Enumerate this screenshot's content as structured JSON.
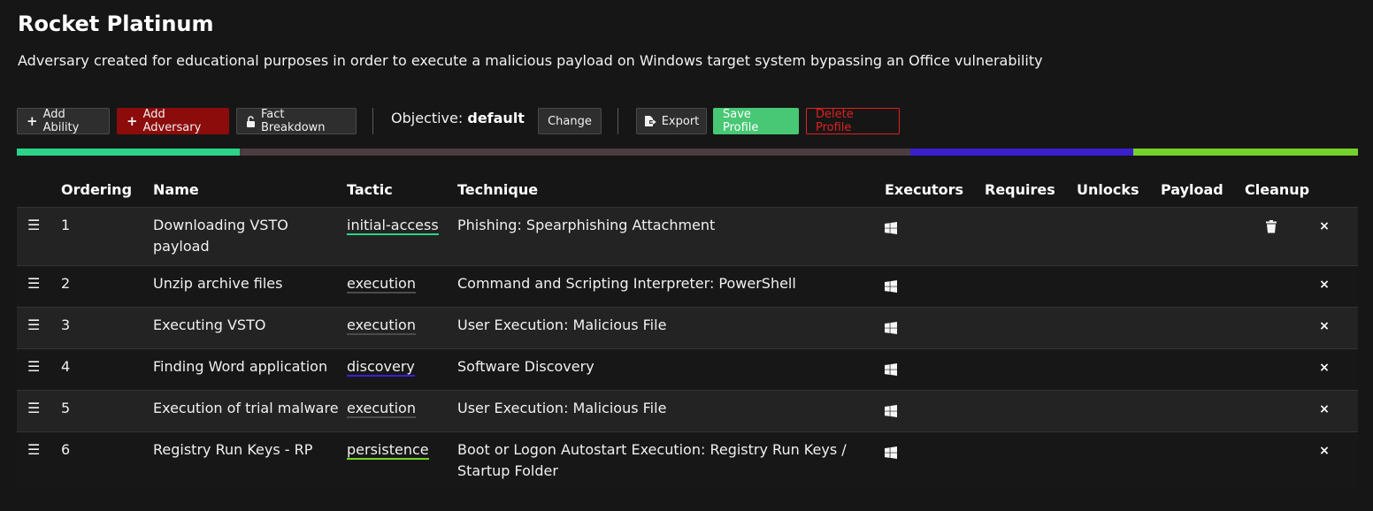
{
  "title": "Rocket Platinum",
  "description": "Adversary created for educational purposes in order to execute a malicious payload on Windows target system bypassing an Office vulnerability",
  "toolbar": {
    "add_ability": "Add Ability",
    "add_adversary": "Add Adversary",
    "fact_breakdown": "Fact Breakdown",
    "objective_label": "Objective:",
    "objective_value": "default",
    "change": "Change",
    "export": "Export",
    "save_profile": "Save Profile",
    "delete_profile": "Delete Profile"
  },
  "tactic_bar": [
    {
      "color": "#2bd38a",
      "fraction": 0.166
    },
    {
      "color": "#4b3d40",
      "fraction": 0.5
    },
    {
      "color": "#3a1fcf",
      "fraction": 0.166
    },
    {
      "color": "#74d22a",
      "fraction": 0.168
    }
  ],
  "table": {
    "headers": {
      "ordering": "Ordering",
      "name": "Name",
      "tactic": "Tactic",
      "technique": "Technique",
      "executors": "Executors",
      "requires": "Requires",
      "unlocks": "Unlocks",
      "payload": "Payload",
      "cleanup": "Cleanup"
    },
    "rows": [
      {
        "order": "1",
        "name": "Downloading VSTO payload",
        "tactic": "initial-access",
        "technique": "Phishing: Spearphishing Attachment",
        "executor_icon": "windows-icon",
        "has_cleanup": true
      },
      {
        "order": "2",
        "name": "Unzip archive files",
        "tactic": "execution",
        "technique": "Command and Scripting Interpreter: PowerShell",
        "executor_icon": "windows-icon",
        "has_cleanup": false
      },
      {
        "order": "3",
        "name": "Executing VSTO",
        "tactic": "execution",
        "technique": "User Execution: Malicious File",
        "executor_icon": "windows-icon",
        "has_cleanup": false
      },
      {
        "order": "4",
        "name": "Finding Word application",
        "tactic": "discovery",
        "technique": "Software Discovery",
        "executor_icon": "windows-icon",
        "has_cleanup": false
      },
      {
        "order": "5",
        "name": "Execution of trial malware",
        "tactic": "execution",
        "technique": "User Execution: Malicious File",
        "executor_icon": "windows-icon",
        "has_cleanup": false
      },
      {
        "order": "6",
        "name": "Registry Run Keys - RP",
        "tactic": "persistence",
        "technique": "Boot or Logon Autostart Execution: Registry Run Keys / Startup Folder",
        "executor_icon": "windows-icon",
        "has_cleanup": false
      }
    ]
  },
  "icons": {
    "handle": "☰",
    "delete": "×",
    "plus": "+"
  }
}
